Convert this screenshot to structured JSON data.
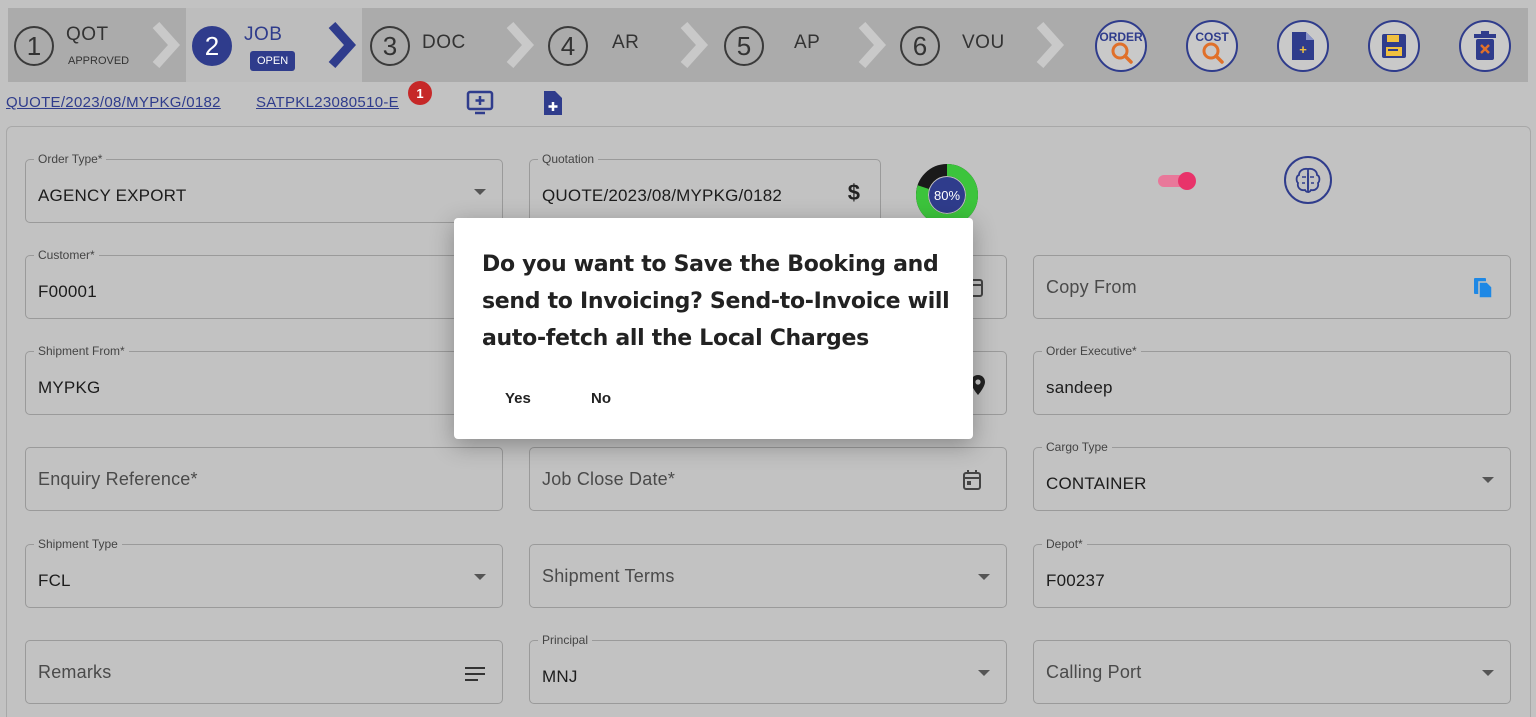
{
  "stepper": {
    "steps": [
      {
        "num": "1",
        "name": "QOT",
        "sub": "APPROVED"
      },
      {
        "num": "2",
        "name": "JOB",
        "badge": "OPEN"
      },
      {
        "num": "3",
        "name": "DOC"
      },
      {
        "num": "4",
        "name": "AR"
      },
      {
        "num": "5",
        "name": "AP"
      },
      {
        "num": "6",
        "name": "VOU"
      }
    ],
    "actions": {
      "order": "ORDER",
      "cost": "COST"
    }
  },
  "links": {
    "quote": "QUOTE/2023/08/MYPKG/0182",
    "booking": "SATPKL23080510-E",
    "notification_count": "1"
  },
  "progress": {
    "percent": 80,
    "label": "80%"
  },
  "form": {
    "order_type": {
      "label": "Order Type*",
      "value": "AGENCY EXPORT"
    },
    "quotation": {
      "label": "Quotation",
      "value": "QUOTE/2023/08/MYPKG/0182"
    },
    "customer": {
      "label": "Customer*",
      "value": "F00001"
    },
    "copy_from": {
      "placeholder": "Copy From"
    },
    "shipment_from": {
      "label": "Shipment From*",
      "value": "MYPKG"
    },
    "order_executive": {
      "label": "Order Executive*",
      "value": "sandeep"
    },
    "enquiry_reference": {
      "placeholder": "Enquiry Reference*"
    },
    "job_close_date": {
      "placeholder": "Job Close Date*"
    },
    "cargo_type": {
      "label": "Cargo Type",
      "value": "CONTAINER"
    },
    "shipment_type": {
      "label": "Shipment Type",
      "value": "FCL"
    },
    "shipment_terms": {
      "placeholder": "Shipment Terms"
    },
    "depot": {
      "label": "Depot*",
      "value": "F00237"
    },
    "remarks": {
      "placeholder": "Remarks"
    },
    "principal": {
      "label": "Principal",
      "value": "MNJ"
    },
    "calling_port": {
      "placeholder": "Calling Port"
    }
  },
  "dialog": {
    "message": "Do you want to Save the Booking and send to Invoicing? Send-to-Invoice will auto-fetch all the Local Charges",
    "yes": "Yes",
    "no": "No"
  },
  "colors": {
    "accent": "#2f3c8c",
    "progress": "#3cc43c",
    "toggle": "#e8336a",
    "badge": "#c62828"
  }
}
